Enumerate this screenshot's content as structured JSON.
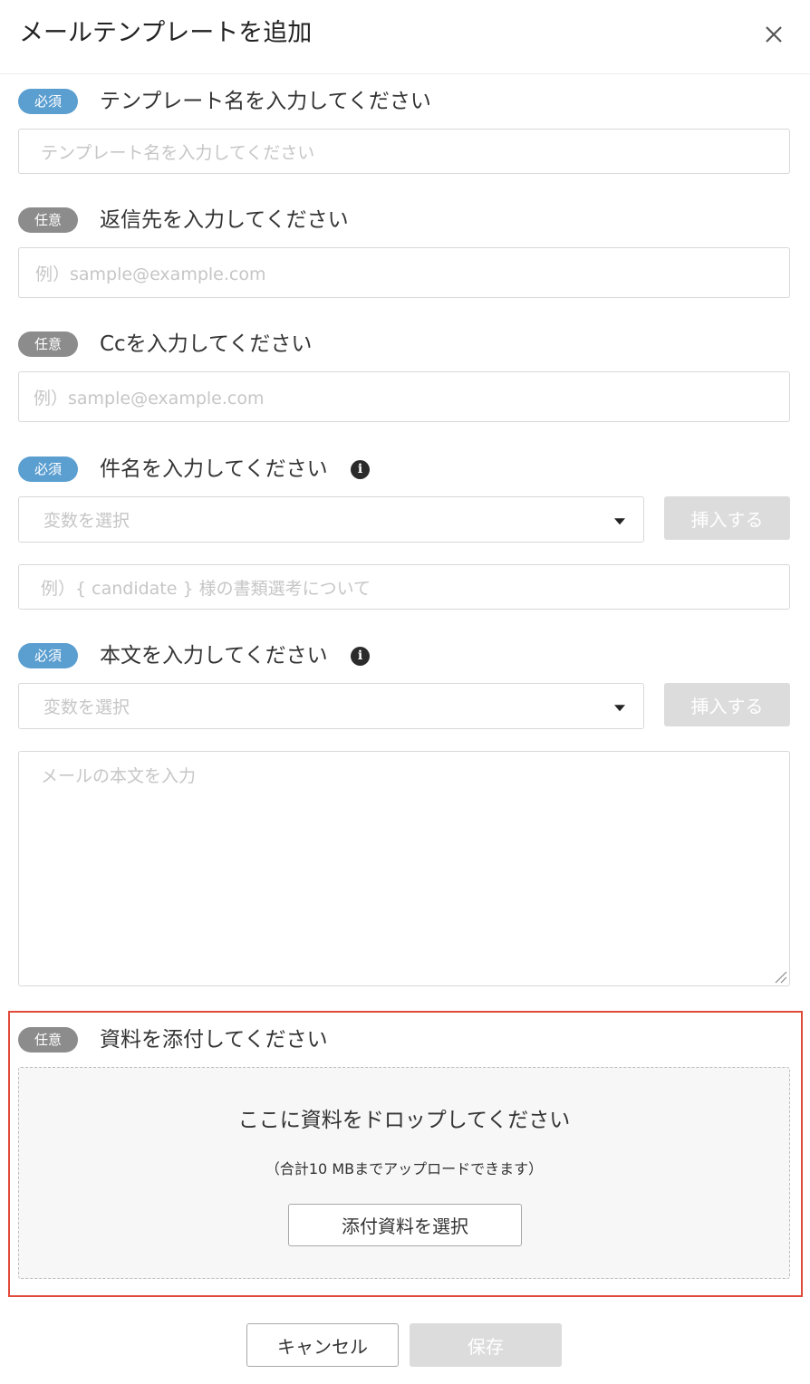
{
  "dialog": {
    "title": "メールテンプレートを追加"
  },
  "badges": {
    "required": "必須",
    "optional": "任意"
  },
  "fields": {
    "template_name": {
      "label": "テンプレート名を入力してください",
      "placeholder": "テンプレート名を入力してください"
    },
    "reply_to": {
      "label": "返信先を入力してください",
      "placeholder": "例）sample@example.com"
    },
    "cc": {
      "label": "Ccを入力してください",
      "placeholder": "例）sample@example.com"
    },
    "subject": {
      "label": "件名を入力してください",
      "variable_placeholder": "変数を選択",
      "insert_label": "挿入する",
      "placeholder": "例）{ candidate } 様の書類選考について"
    },
    "body": {
      "label": "本文を入力してください",
      "variable_placeholder": "変数を選択",
      "insert_label": "挿入する",
      "placeholder": "メールの本文を入力"
    },
    "attachment": {
      "label": "資料を添付してください",
      "drop_title": "ここに資料をドロップしてください",
      "drop_note": "（合計10 MBまでアップロードできます）",
      "select_label": "添付資料を選択"
    }
  },
  "footer": {
    "cancel_label": "キャンセル",
    "save_label": "保存"
  },
  "colors": {
    "required_badge": "#5b9ed0",
    "optional_badge": "#8c8c8c",
    "highlight_border": "#e04a3a",
    "disabled_button": "#dcdcdc"
  },
  "icons": {
    "close": "close-icon",
    "info": "info-icon",
    "caret": "caret-down-icon"
  }
}
